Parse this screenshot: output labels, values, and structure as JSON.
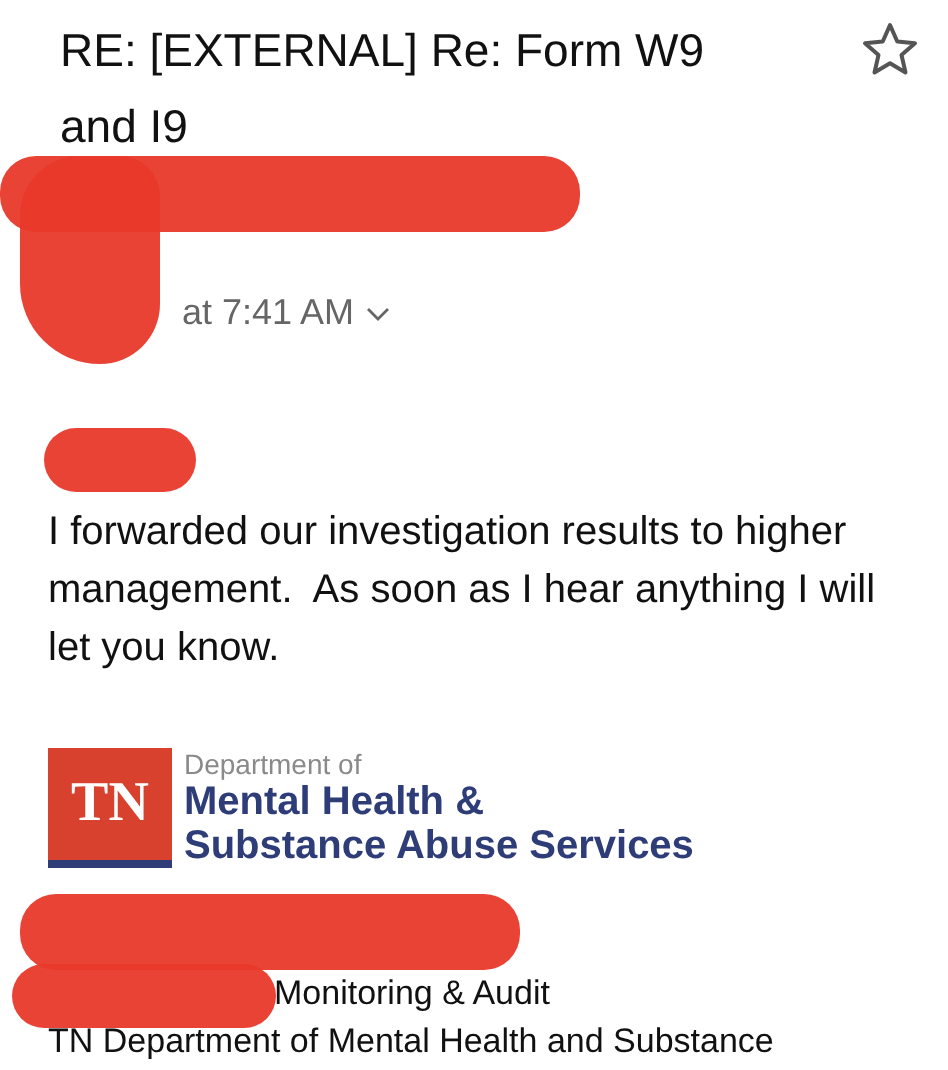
{
  "header": {
    "subject": "RE: [EXTERNAL] Re: Form W9 and I9",
    "starred": false
  },
  "message": {
    "time": "at 7:41 AM",
    "body": "I forwarded our investigation results to higher management.  As soon as I hear anything I will let you know."
  },
  "signature": {
    "logo": {
      "mark": "TN",
      "line_1": "Department of",
      "line_2": "Mental Health &",
      "line_3": "Substance Abuse Services"
    },
    "unit": "Monitoring & Audit",
    "organization": "TN Department of Mental Health and Substance"
  }
}
